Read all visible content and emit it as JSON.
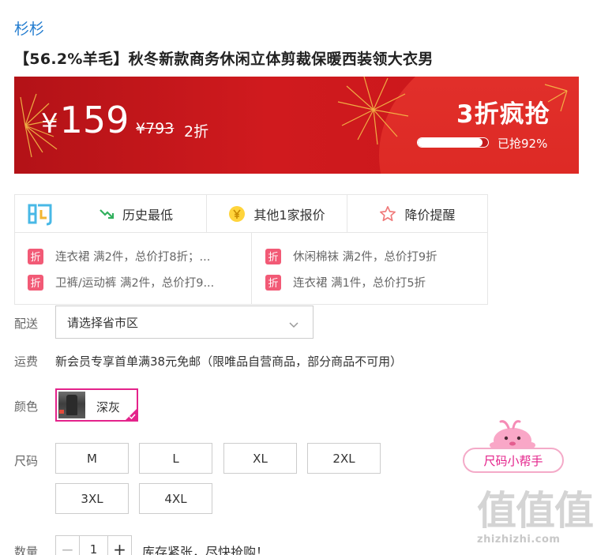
{
  "brand": "杉杉",
  "product_title": "【56.2%羊毛】秋冬新款商务休闲立体剪裁保暖西装领大衣男",
  "banner": {
    "currency": "¥",
    "price": "159",
    "original_price": "¥793",
    "discount": "2折",
    "sale_title": "3折疯抢",
    "sold_fraction": 0.92,
    "sold_text": "已抢92%",
    "colors": {
      "primary": "#c8161a",
      "accent": "#e3322d"
    }
  },
  "promo": {
    "logo_icon": "gou-logo-icon",
    "actions": [
      {
        "label": "历史最低",
        "icon": "trend-down-icon"
      },
      {
        "label": "其他1家报价",
        "icon": "yen-coin-icon"
      },
      {
        "label": "降价提醒",
        "icon": "star-outline-icon"
      }
    ],
    "tag_label": "折",
    "items": [
      "连衣裙 满2件，总价打8折；...",
      "卫裤/运动裤 满2件，总价打9...",
      "休闲棉袜 满2件，总价打9折",
      "连衣裙 满1件，总价打5折"
    ]
  },
  "delivery": {
    "label": "配送",
    "placeholder": "请选择省市区",
    "icon": "chevron-down-icon"
  },
  "shipping": {
    "label": "运费",
    "text": "新会员专享首单满38元免邮（限唯品自营商品，部分商品不可用）"
  },
  "color": {
    "label": "颜色",
    "selected": "深灰",
    "accent": "#e4238b"
  },
  "size": {
    "label": "尺码",
    "options": [
      "M",
      "L",
      "XL",
      "2XL",
      "3XL",
      "4XL"
    ]
  },
  "quantity": {
    "label": "数量",
    "value": "1",
    "minus": "−",
    "plus": "+",
    "stock_note": "库存紧张，尽快抢购！"
  },
  "size_helper": {
    "label": "尺码小帮手"
  },
  "watermark": {
    "text": "值值值",
    "site": "zhizhizhi.com"
  }
}
